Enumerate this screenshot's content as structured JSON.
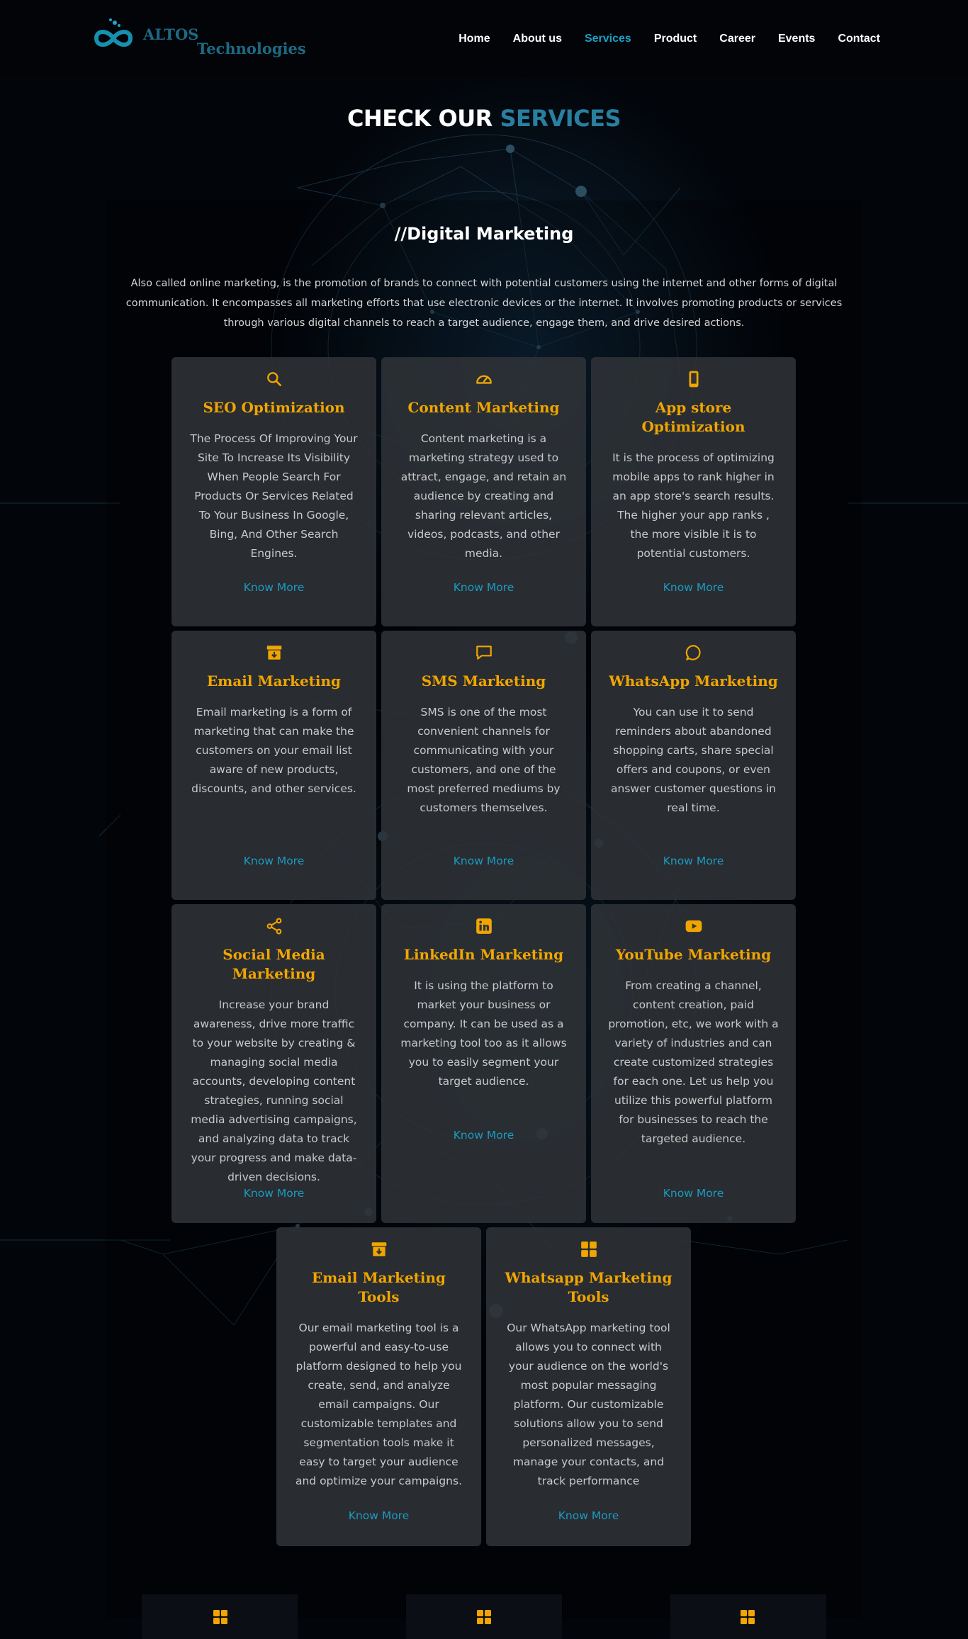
{
  "header": {
    "logo_line1": "ALTOS",
    "logo_line2": "Technologies",
    "nav": [
      {
        "label": "Home"
      },
      {
        "label": "About us"
      },
      {
        "label": "Services"
      },
      {
        "label": "Product"
      },
      {
        "label": "Career"
      },
      {
        "label": "Events"
      },
      {
        "label": "Contact"
      }
    ],
    "active_nav": "Services"
  },
  "section": {
    "title_white": "CHECK OUR",
    "title_blue": "SERVICES",
    "subtitle": "//Digital Marketing",
    "description": "Also called online marketing, is the promotion of brands to connect with potential customers using the internet and other forms of digital communication. It encompasses all marketing efforts that use electronic devices or the internet. It involves promoting products or services through various digital channels to reach a target audience, engage them, and drive desired actions."
  },
  "colors": {
    "accent_orange": "#f0a500",
    "link_blue": "#1c9bc0",
    "title_blue": "#2a7fa0",
    "card_bg": "#303338"
  },
  "cards": [
    {
      "icon": "search-icon",
      "title": "SEO Optimization",
      "desc": "The Process Of Improving Your Site To Increase Its Visibility When People Search For Products Or Services Related To Your Business In Google, Bing, And Other Search Engines.",
      "link": "Know More"
    },
    {
      "icon": "speedometer-icon",
      "title": "Content Marketing",
      "desc": "Content marketing is a marketing strategy used to attract, engage, and retain an audience by creating and sharing relevant articles, videos, podcasts, and other media.",
      "link": "Know More"
    },
    {
      "icon": "phone-icon",
      "title": "App store Optimization",
      "desc": "It is the process of optimizing mobile apps to rank higher in an app store's search results. The higher your app ranks , the more visible it is to potential customers.",
      "link": "Know More"
    },
    {
      "icon": "archive-icon",
      "title": "Email Marketing",
      "desc": "Email marketing is a form of marketing that can make the customers on your email list aware of new products, discounts, and other services.",
      "link": "Know More"
    },
    {
      "icon": "chat-icon",
      "title": "SMS Marketing",
      "desc": "SMS is one of the most convenient channels for communicating with your customers, and one of the most preferred mediums by customers themselves.",
      "link": "Know More"
    },
    {
      "icon": "whatsapp-icon",
      "title": "WhatsApp Marketing",
      "desc": "You can use it to send reminders about abandoned shopping carts, share special offers and coupons, or even answer customer questions in real time.",
      "link": "Know More"
    },
    {
      "icon": "share-icon",
      "title": "Social Media Marketing",
      "desc": "Increase your brand awareness, drive more traffic to your website by creating & managing social media accounts, developing content strategies, running social media advertising campaigns, and analyzing data to track your progress and make data-driven decisions.",
      "link": "Know More"
    },
    {
      "icon": "linkedin-icon",
      "title": "LinkedIn Marketing",
      "desc": "It is using the platform to market your business or company. It can be used as a marketing tool too as it allows you to easily segment your target audience.",
      "link": "Know More"
    },
    {
      "icon": "youtube-icon",
      "title": "YouTube Marketing",
      "desc": "From creating a channel, content creation, paid promotion, etc, we work with a variety of industries and can create customized strategies for each one. Let us help you utilize this powerful platform for businesses to reach the targeted audience.",
      "link": "Know More"
    },
    {
      "icon": "archive-icon",
      "title": "Email Marketing Tools",
      "desc": "Our email marketing tool is a powerful and easy-to-use platform designed to help you create, send, and analyze email campaigns. Our customizable templates and segmentation tools make it easy to target your audience and optimize your campaigns.",
      "link": "Know More"
    },
    {
      "icon": "grid-icon",
      "title": "Whatsapp Marketing Tools",
      "desc": "Our WhatsApp marketing tool allows you to connect with your audience on the world's most popular messaging platform. Our customizable solutions allow you to send personalized messages, manage your contacts, and track performance",
      "link": "Know More"
    }
  ],
  "bottom_icons": [
    "grid-icon",
    "grid-icon",
    "grid-icon"
  ]
}
